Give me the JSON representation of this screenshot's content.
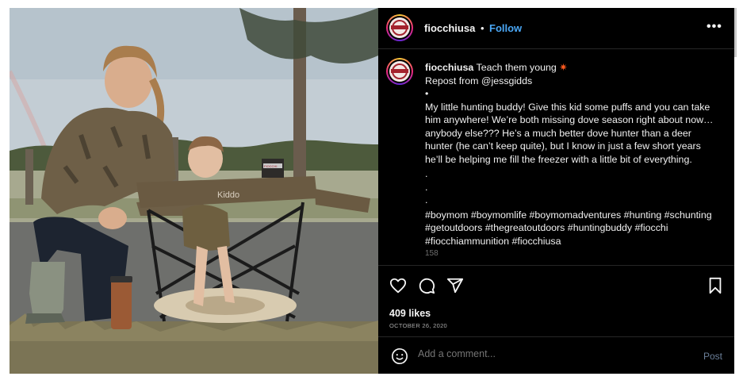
{
  "post": {
    "username": "fiocchiusa",
    "separator": "•",
    "follow_label": "Follow",
    "more_label": "•••",
    "caption": {
      "username": "fiocchiusa",
      "headline": "Teach them young",
      "sparkle": "✷",
      "repost": "Repost from @jessgidds",
      "bullet": "•",
      "body": "My little hunting buddy! Give this kid some puffs and you can take him anywhere! We’re both missing dove season right about now…anybody else??? He’s a much better dove hunter than a deer hunter (he can’t keep quite), but I know in just a few short years he’ll be helping me fill the freezer with a little bit of everything.",
      "dots": ".\n.\n.",
      "hashtags": "#boymom #boymomlife #boymomadventures #hunting #schunting #getoutdoors #thegreatoutdoors #huntingbuddy #fiocchi #fiocchiammunition #fiocchiusa",
      "cutoff": "158"
    },
    "likes": "409 likes",
    "date": "OCTOBER 26, 2020",
    "comment": {
      "placeholder": "Add a comment...",
      "post_label": "Post"
    },
    "photo": {
      "chair_label": "Kiddo",
      "box_label": "FIOCCHI"
    }
  },
  "icons": {
    "like": "heart-icon",
    "comment": "comment-icon",
    "share": "paper-plane-icon",
    "save": "bookmark-icon",
    "emoji": "smiley-icon",
    "more": "more-options-icon"
  },
  "colors": {
    "panel_bg": "#000000",
    "follow": "#4aa7f5",
    "post_disabled": "#6b7f99",
    "brand_red": "#a3232d"
  }
}
